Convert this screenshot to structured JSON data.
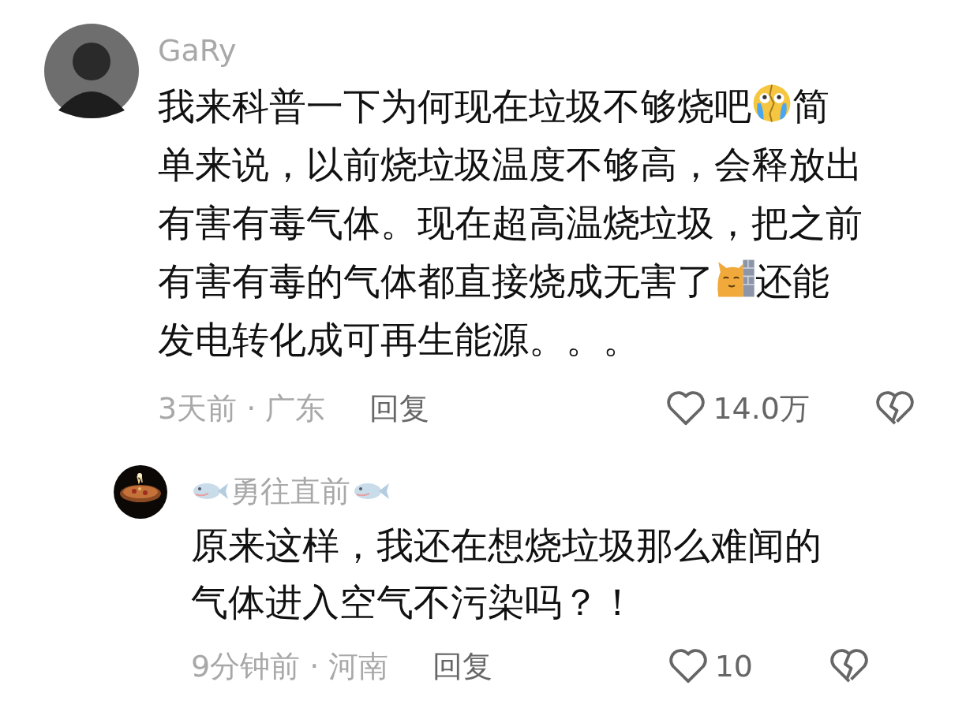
{
  "comments": [
    {
      "author": "GaRy",
      "name_fish": false,
      "lines": [
        [
          {
            "kind": "text",
            "text": "我来科普一下为何现在垃圾不够烧吧"
          },
          {
            "kind": "crying"
          },
          {
            "kind": "text",
            "text": "简"
          }
        ],
        [
          {
            "kind": "text",
            "text": "单来说，以前烧垃圾温度不够高，会释放出"
          }
        ],
        [
          {
            "kind": "text",
            "text": "有害有毒气体。现在超高温烧垃圾，把之前"
          }
        ],
        [
          {
            "kind": "text",
            "text": "有害有毒的气体都直接烧成无害了"
          },
          {
            "kind": "cat"
          },
          {
            "kind": "text",
            "text": "还能"
          }
        ],
        [
          {
            "kind": "text",
            "text": "发电转化成可再生能源。。。"
          }
        ]
      ],
      "time": "3天前",
      "separator": "·",
      "location": "广东",
      "reply_label": "回复",
      "likes": "14.0万",
      "replies": [
        {
          "author": "勇往直前",
          "name_fish": true,
          "lines": [
            [
              {
                "kind": "text",
                "text": "原来这样，我还在想烧垃圾那么难闻的"
              }
            ],
            [
              {
                "kind": "text",
                "text": "气体进入空气不污染吗？！"
              }
            ]
          ],
          "time": "9分钟前",
          "separator": "·",
          "location": "河南",
          "reply_label": "回复",
          "likes": "10"
        }
      ]
    }
  ]
}
